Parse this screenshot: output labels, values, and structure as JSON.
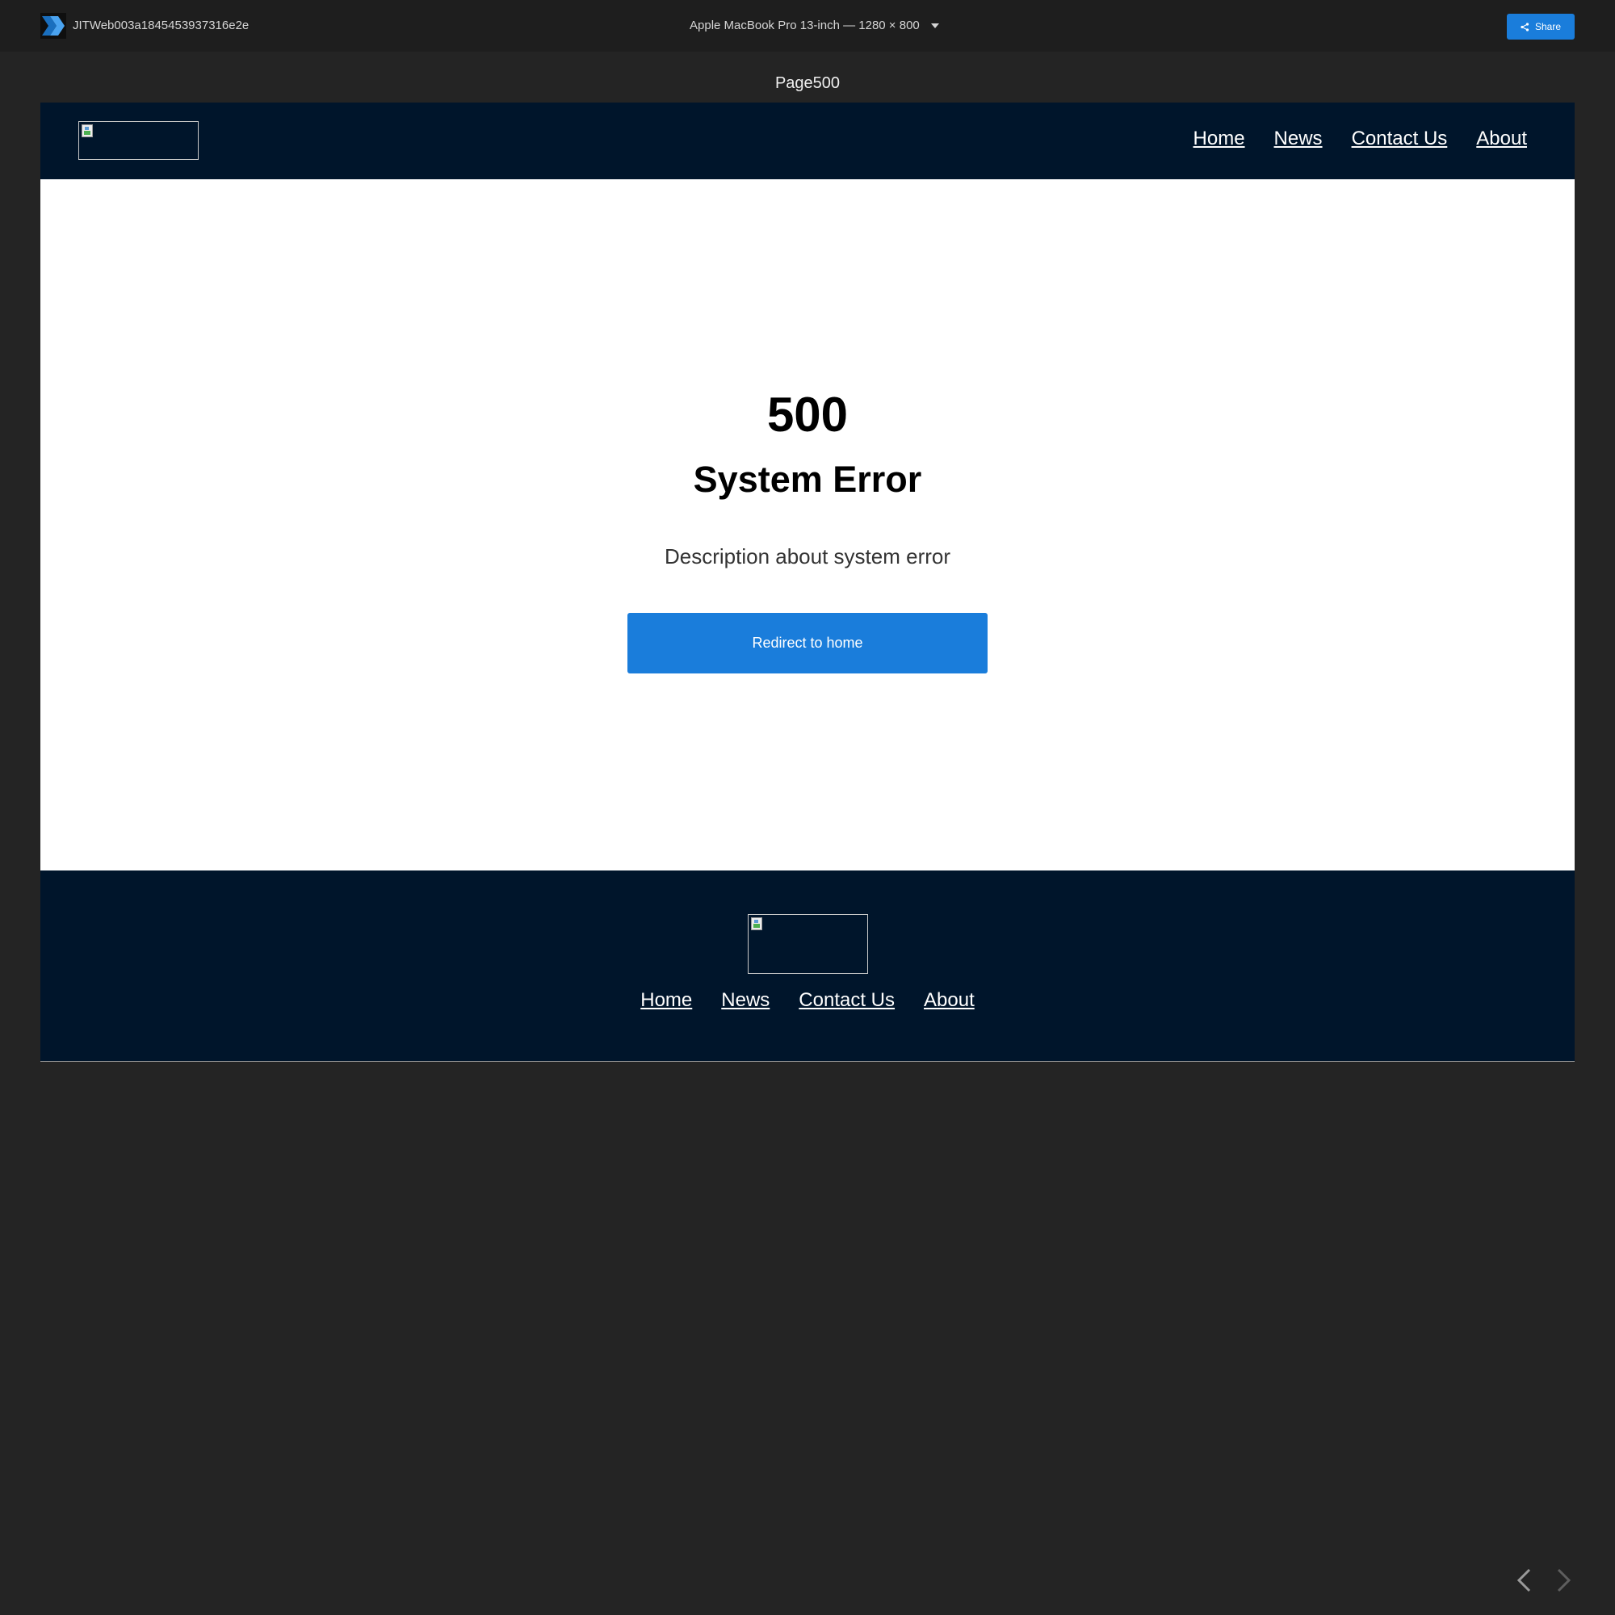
{
  "toolbar": {
    "project_name": "JITWeb003a1845453937316e2e",
    "device_label": "Apple MacBook Pro 13-inch — 1280 × 800",
    "share_label": "Share",
    "accent_color": "#1a7ddb"
  },
  "page_title": "Page500",
  "site": {
    "header_bg": "#00152b",
    "nav": [
      {
        "label": "Home"
      },
      {
        "label": "News"
      },
      {
        "label": "Contact Us"
      },
      {
        "label": "About"
      }
    ],
    "error": {
      "code": "500",
      "title": "System Error",
      "description": "Description about system error",
      "button_label": "Redirect to home"
    },
    "footer_nav": [
      {
        "label": "Home"
      },
      {
        "label": "News"
      },
      {
        "label": "Contact Us"
      },
      {
        "label": "About"
      }
    ]
  },
  "icons": {
    "app_logo": "chevron-double-right-icon",
    "device_dropdown": "caret-down-icon",
    "share": "share-icon",
    "prev": "chevron-left-icon",
    "next": "chevron-right-icon"
  }
}
